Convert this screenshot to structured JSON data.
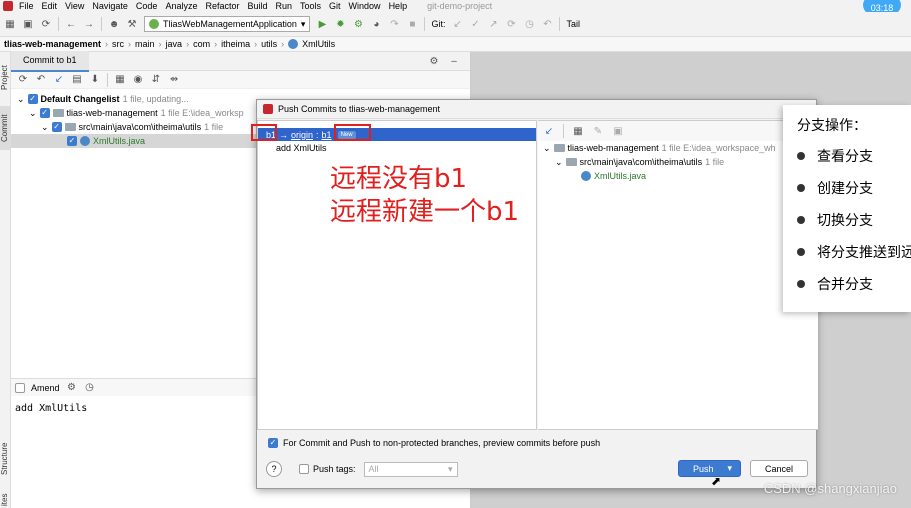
{
  "menu": {
    "items": [
      "File",
      "Edit",
      "View",
      "Navigate",
      "Code",
      "Analyze",
      "Refactor",
      "Build",
      "Run",
      "Tools",
      "Git",
      "Window",
      "Help"
    ],
    "project": "git-demo-project"
  },
  "timer": "03:18",
  "toolbar": {
    "run_config": "TliasWebManagementApplication",
    "git_label": "Git:",
    "tail_label": "Tail"
  },
  "breadcrumb": {
    "items": [
      "tlias-web-management",
      "src",
      "main",
      "java",
      "com",
      "itheima",
      "utils",
      "XmlUtils"
    ]
  },
  "sidebar": {
    "project_tab": "Project",
    "commit_tab": "Commit",
    "structure_tab": "Structure",
    "bottom_tab": "ites"
  },
  "commit_panel": {
    "tab_label": "Commit to b1",
    "changelist": {
      "label": "Default Changelist",
      "info": "1 file, updating..."
    },
    "module": {
      "label": "tlias-web-management",
      "info": "1 file  E:\\idea_worksp"
    },
    "folder": {
      "label": "src\\main\\java\\com\\itheima\\utils",
      "info": "1 file"
    },
    "file": "XmlUtils.java",
    "amend_label": "Amend",
    "commit_message": "add XmlUtils"
  },
  "dialog": {
    "title": "Push Commits to tlias-web-management",
    "branch": {
      "local": "b1",
      "arrow": "→",
      "remote_prefix": "origin",
      "separator": ":",
      "remote_branch": "b1",
      "badge": "New"
    },
    "commits": [
      "add XmlUtils"
    ],
    "right_tree": {
      "module": {
        "label": "tlias-web-management",
        "info": "1 file  E:\\idea_workspace_wh"
      },
      "folder": {
        "label": "src\\main\\java\\com\\itheima\\utils",
        "info": "1 file"
      },
      "file": "XmlUtils.java"
    },
    "annotation": {
      "line1": "远程没有b1",
      "line2": "远程新建一个b1"
    },
    "preview_checkbox_label": "For Commit and Push to non-protected branches, preview commits before push",
    "push_tags_label": "Push tags:",
    "push_tags_value": "All",
    "push_button": "Push",
    "cancel_button": "Cancel",
    "help_label": "?"
  },
  "ppt_panel": {
    "title": "分支操作：",
    "items": [
      "查看分支",
      "创建分支",
      "切换分支",
      "将分支推送到远",
      "合并分支"
    ]
  },
  "watermark": "CSDN @shangxianjiao",
  "colors": {
    "accent": "#2f65ca",
    "annotation_red": "#e0201e",
    "timer_blue": "#3fa9f5"
  }
}
